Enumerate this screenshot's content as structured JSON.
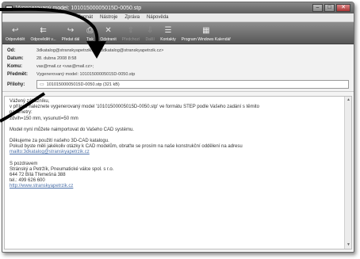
{
  "window": {
    "title": "Vygenerovaný model: 10101500005015D-0050.stp",
    "controls": {
      "minimize": "–",
      "maximize": "□",
      "close": "✕"
    }
  },
  "menu": [
    "Formát",
    "Nástroje",
    "Zpráva",
    "Nápověda"
  ],
  "toolbar": [
    {
      "label": "Odpovědět",
      "icon": "reply-icon",
      "glyph": "↩",
      "enabled": true
    },
    {
      "label": "Odpovědět v...",
      "icon": "reply-all-icon",
      "glyph": "⇇",
      "enabled": true
    },
    {
      "label": "Předat dál",
      "icon": "forward-icon",
      "glyph": "↪",
      "enabled": true
    },
    {
      "label": "Tisk",
      "icon": "print-icon",
      "glyph": "⎙",
      "enabled": true
    },
    {
      "label": "Odstranit",
      "icon": "delete-icon",
      "glyph": "✕",
      "enabled": true
    },
    {
      "label": "Předchozí",
      "icon": "previous-icon",
      "glyph": "⇧",
      "enabled": false
    },
    {
      "label": "Další",
      "icon": "next-icon",
      "glyph": "⇩",
      "enabled": false
    },
    {
      "label": "Kontakty",
      "icon": "contacts-icon",
      "glyph": "☰",
      "enabled": true
    },
    {
      "label": "Program Windows Kalendář",
      "icon": "calendar-icon",
      "glyph": "▦",
      "enabled": true
    }
  ],
  "headers": {
    "from": {
      "label": "Od:",
      "value": "3dkatalog@stranskyapetrzik.cz <3dkatalog@stranskyapetrzik.cz>"
    },
    "date": {
      "label": "Datum:",
      "value": "28. dubna 2008 8:58"
    },
    "to": {
      "label": "Komu:",
      "value": "vas@mail.cz <vas@mail.cz>;"
    },
    "subject": {
      "label": "Předmět:",
      "value": "Vygenerovaný model: 10101500005015D-0050.stp"
    },
    "attachments": {
      "label": "Přílohy:",
      "value": "10101500005015D-0050.stp (321 kB)"
    }
  },
  "message": {
    "greeting": "Vážený zákazníku,",
    "line1": "v příloze naleznete vygenerovaný model '10101500005015D-0050.stp' ve formátu STEP podle Vašeho zadání s těmito",
    "line2": "parametry:",
    "line3": "zdvih=150 mm, vysunutí=50 mm",
    "line4": "Model nyní můžete naimportovat do Vašeho CAD systému.",
    "line5": "Děkujeme za použití našeho 3D-CAD katalogu.",
    "line6": "Pokud byste měli jakékoliv otázky k CAD modelům, obraťte se prosím na naše konstrukční oddělení na adresu",
    "link1": "mailto:3dkatalog@stranskyapetrzik.cz",
    "closing": "S pozdravem",
    "sig1": "Stránský a Petržík, Pneumatické válce spol. s r.o.",
    "sig2": "644 72 Bílá Třemešná 388",
    "sig3": "tel.: 499 626 600",
    "link2": "http://www.stranskyapetrzik.cz"
  },
  "scrollbar": {
    "up": "▲",
    "down": "▼"
  },
  "colors": {
    "titlebar": "#6e6e6e",
    "toolbar": "#707070",
    "link": "#4a6fa8",
    "arrow": "#000000"
  }
}
